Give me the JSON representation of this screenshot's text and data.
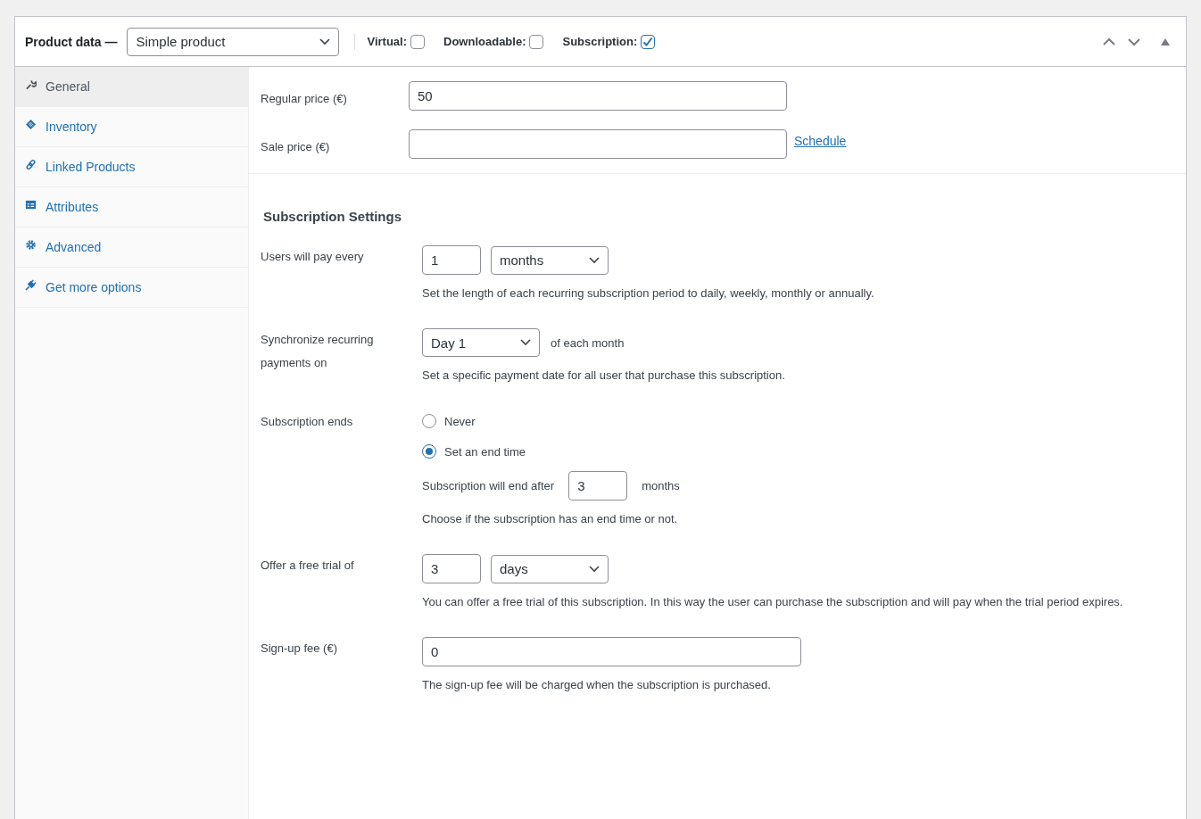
{
  "panel": {
    "title": "Product data —",
    "product_type": "Simple product",
    "checks": [
      {
        "label": "Virtual:",
        "checked": false
      },
      {
        "label": "Downloadable:",
        "checked": false
      },
      {
        "label": "Subscription:",
        "checked": true
      }
    ]
  },
  "tabs": [
    {
      "label": "General",
      "selected": true
    },
    {
      "label": "Inventory",
      "selected": false
    },
    {
      "label": "Linked Products",
      "selected": false
    },
    {
      "label": "Attributes",
      "selected": false
    },
    {
      "label": "Advanced",
      "selected": false
    },
    {
      "label": "Get more options",
      "selected": false
    }
  ],
  "pricing": [
    {
      "label": "Regular price (€)",
      "value": "50"
    },
    {
      "label": "Sale price (€)",
      "link": "Schedule"
    }
  ],
  "section_title": "Subscription Settings",
  "rows": [
    {
      "kind": "number_select",
      "label": "Users will pay every",
      "number": "1",
      "select": "months",
      "help": "Set the length of each recurring subscription period to daily, weekly, monthly or annually."
    },
    {
      "kind": "select_text",
      "label": "Synchronize recurring payments on",
      "select": "Day 1",
      "suffix": "of each month",
      "help": "Set a specific payment date for all user that purchase this subscription."
    },
    {
      "kind": "radios",
      "label": "Subscription ends",
      "options": [
        {
          "label": "Never",
          "selected": false
        },
        {
          "label": "Set an end time",
          "selected": true
        }
      ],
      "sub": {
        "label": "Subscription will end after",
        "value": "3",
        "suffix": "months"
      },
      "help": "Choose if the subscription has an end time or not."
    },
    {
      "kind": "number_select",
      "label": "Offer a free trial of",
      "number": "3",
      "select": "days",
      "help": "You can offer a free trial of this subscription. In this way the user can purchase the subscription and will pay when the trial period expires."
    },
    {
      "kind": "text",
      "label": "Sign-up fee (€)",
      "value": "0",
      "help": "The sign-up fee will be charged when the subscription is purchased."
    }
  ]
}
